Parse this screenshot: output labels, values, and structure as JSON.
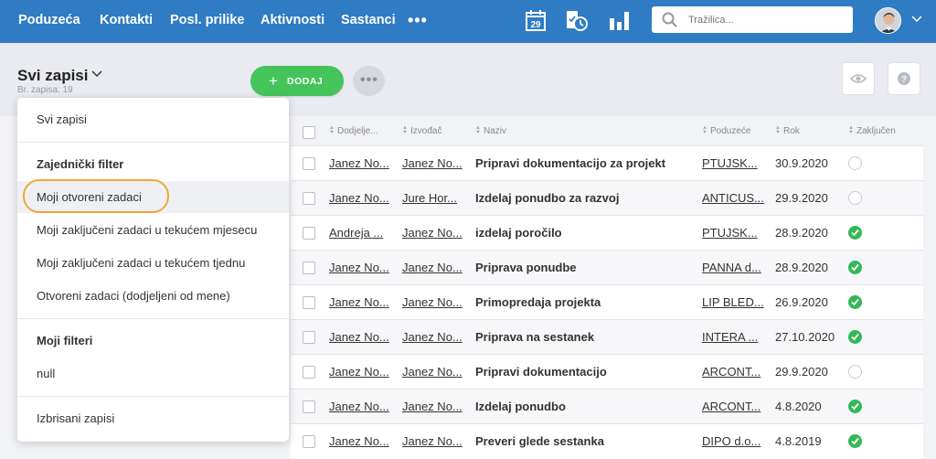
{
  "nav": {
    "items": [
      "Poduzeća",
      "Kontakti",
      "Posl. prilike",
      "Aktivnosti",
      "Sastanci"
    ],
    "more_label": "•••"
  },
  "toolbar": {
    "calendar_day": "29",
    "search_placeholder": "Tražilica..."
  },
  "page": {
    "title": "Svi zapisi",
    "record_count": "Br. zapisa: 19",
    "add_button": "DODAJ"
  },
  "dropdown": {
    "all_records": "Svi zapisi",
    "shared_filter_heading": "Zajednički filter",
    "shared_filters": [
      "Moji otvoreni zadaci",
      "Moji zaključeni zadaci u tekućem mjesecu",
      "Moji zaključeni zadaci u tekućem tjednu",
      "Otvoreni zadaci (dodjeljeni od mene)"
    ],
    "my_filters_heading": "Moji filteri",
    "my_filters": [
      "null"
    ],
    "deleted_records": "Izbrisani zapisi"
  },
  "table": {
    "columns": [
      "Dodjelje...",
      "Izvođač",
      "Naziv",
      "Poduzeće",
      "Rok",
      "Zaključen"
    ],
    "rows": [
      {
        "assignee": "Janez No...",
        "executor": "Janez No...",
        "name": "Pripravi dokumentacijo za projekt",
        "company": "PTUJSK...",
        "due": "30.9.2020",
        "closed": false
      },
      {
        "assignee": "Janez No...",
        "executor": "Jure Hor...",
        "name": "Izdelaj ponudbo za razvoj",
        "company": "ANTICUS...",
        "due": "29.9.2020",
        "closed": false
      },
      {
        "assignee": "Andreja ...",
        "executor": "Janez No...",
        "name": "izdelaj poročilo",
        "company": "PTUJSK...",
        "due": "28.9.2020",
        "closed": true
      },
      {
        "assignee": "Janez No...",
        "executor": "Janez No...",
        "name": "Priprava ponudbe",
        "company": "PANNA d...",
        "due": "28.9.2020",
        "closed": true
      },
      {
        "assignee": "Janez No...",
        "executor": "Janez No...",
        "name": "Primopredaja projekta",
        "company": "LIP BLED...",
        "due": "26.9.2020",
        "closed": true
      },
      {
        "assignee": "Janez No...",
        "executor": "Janez No...",
        "name": "Priprava na sestanek",
        "company": "INTERA ...",
        "due": "27.10.2020",
        "closed": true
      },
      {
        "assignee": "Janez No...",
        "executor": "Janez No...",
        "name": "Pripravi dokumentacijo",
        "company": "ARCONT...",
        "due": "29.9.2020",
        "closed": false
      },
      {
        "assignee": "Janez No...",
        "executor": "Janez No...",
        "name": "Izdelaj ponudbo",
        "company": "ARCONT...",
        "due": "4.8.2020",
        "closed": true
      },
      {
        "assignee": "Janez No...",
        "executor": "Janez No...",
        "name": "Preveri glede sestanka",
        "company": "DIPO d.o...",
        "due": "4.8.2019",
        "closed": true
      }
    ]
  },
  "colors": {
    "topbar": "#2f7bc4",
    "add_button": "#45c45b",
    "done_status": "#32b957",
    "highlight": "#f0a73a"
  }
}
